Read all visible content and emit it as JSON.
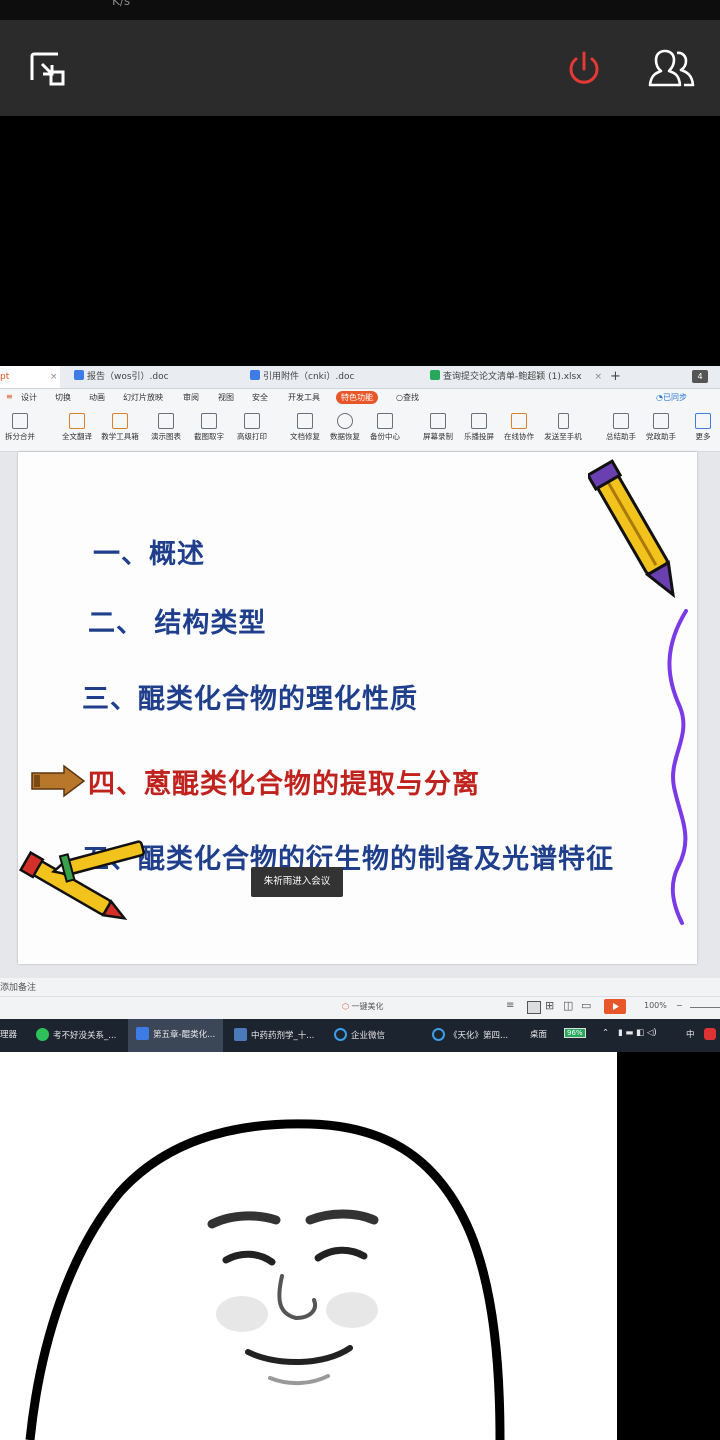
{
  "status": {
    "fragment": "K/s"
  },
  "meeting_bar": {
    "exit_fullscreen_icon": "exit-fullscreen-icon",
    "leave_icon": "power-icon",
    "participants_icon": "participants-icon",
    "leave_color": "#e53935"
  },
  "wps": {
    "tabs": [
      {
        "label": "pt"
      },
      {
        "label": "报告（wos引）.doc"
      },
      {
        "label": "引用附件（cnki）.doc"
      },
      {
        "label": "查询提交论文清单-鲍超颖 (1).xlsx"
      }
    ],
    "tab_add": "+",
    "tab_count": "4",
    "menu": [
      "设计",
      "切换",
      "动画",
      "幻灯片放映",
      "审阅",
      "视图",
      "安全",
      "开发工具",
      "特色功能",
      "查找"
    ],
    "sync_label": "已同步",
    "ribbon": [
      "拆分合并",
      "全文翻译",
      "教学工具箱",
      "演示图表",
      "截图取字",
      "高级打印",
      "文档修复",
      "数据恢复",
      "备份中心",
      "屏幕录制",
      "乐播投屏",
      "在线协作",
      "发送至手机",
      "总结助手",
      "党政助手",
      "更多"
    ],
    "slide": {
      "items": [
        "一、概述",
        "二、 结构类型",
        "三、醌类化合物的理化性质",
        "四、蒽醌类化合物的提取与分离",
        "五、醌类化合物的衍生物的制备及光谱特征"
      ],
      "highlight_index": 3,
      "text_color": "#1f3f8c",
      "highlight_color": "#c0221d"
    },
    "toast": "朱祈雨进入会议",
    "notes_placeholder": "添加备注",
    "beautify_label": "一键美化",
    "zoom": "100%"
  },
  "taskbar": {
    "items": [
      "理器",
      "考不好没关系_...",
      "第五章-醌类化...",
      "中药药剂学_十...",
      "企业微信",
      "《天化》第四...",
      "桌面"
    ],
    "battery": "96%",
    "ime": "中"
  },
  "video_tile": {
    "content": "meme-face-sticker"
  }
}
